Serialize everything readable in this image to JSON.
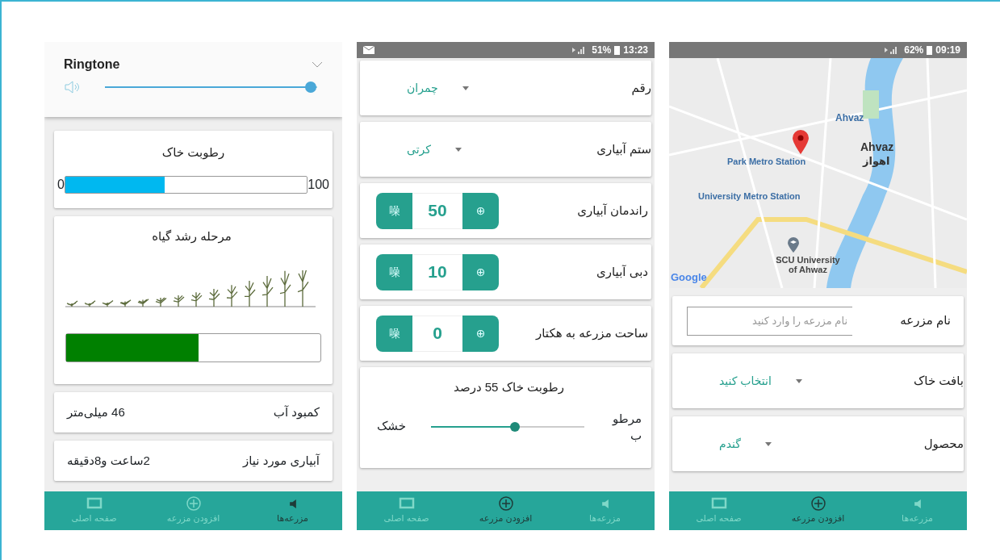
{
  "phones": [
    {
      "status_bar": {
        "mail_notification": false,
        "battery": "62%",
        "time": "09:19"
      },
      "map": {
        "labels": [
          {
            "kind": "metro",
            "text": "Ahvaz"
          },
          {
            "kind": "city",
            "text": "Ahvaz"
          },
          {
            "kind": "city_local",
            "text": "اهواز"
          },
          {
            "kind": "park_metro",
            "text": "Park Metro Station"
          },
          {
            "kind": "uni_metro",
            "text": "University Metro Station"
          },
          {
            "kind": "university",
            "text": "SCU University of Ahwaz"
          },
          {
            "kind": "google",
            "text": "Google"
          }
        ]
      },
      "rows": [
        {
          "kind": "input",
          "label": "نام مزرعه",
          "placeholder": "نام مزرعه را وارد کنید"
        },
        {
          "kind": "select",
          "label": "بافت خاک",
          "value": "انتخاب کنید"
        },
        {
          "kind": "select",
          "label": "محصول",
          "value": "گندم"
        }
      ],
      "nav": [
        {
          "label": "مزرعه‌ها",
          "selected": false
        },
        {
          "label": "افزودن مزرعه",
          "selected": true
        },
        {
          "label": "صفحه اصلی",
          "selected": false
        }
      ]
    },
    {
      "status_bar": {
        "mail_notification": true,
        "battery": "51%",
        "time": "13:23"
      },
      "rows": [
        {
          "kind": "select",
          "label": "رقم",
          "value": "چمران"
        },
        {
          "kind": "select",
          "label": "ستم آبیاری",
          "value": "کرتی"
        },
        {
          "kind": "stepper",
          "label": "راندمان آبیاری",
          "minus": "噪",
          "value": "50",
          "plus": "⊕"
        },
        {
          "kind": "stepper",
          "label": "دبی آبیاری",
          "minus": "噪",
          "value": "10",
          "plus": "⊕"
        },
        {
          "kind": "stepper",
          "label": "ساحت مزرعه به هکتار",
          "minus": "噪",
          "value": "0",
          "plus": "⊕"
        }
      ],
      "moisture_slider": {
        "title": "رطوبت خاک 55 درصد",
        "wet_label": "مرطوب",
        "dry_label": "خشک",
        "level": 0.55
      },
      "nav": [
        {
          "label": "مزرعه‌ها",
          "selected": false
        },
        {
          "label": "افزودن مزرعه",
          "selected": true
        },
        {
          "label": "صفحه اصلی",
          "selected": false
        }
      ]
    },
    {
      "volume_popup": {
        "title": "Ringtone",
        "level": 0.97
      },
      "soil_moisture": {
        "title": "رطوبت خاک",
        "min": "0",
        "max": "100",
        "level": 0.41
      },
      "growth_stage": {
        "title": "مرحله رشد گیاه",
        "level": 0.52
      },
      "info_rows": [
        {
          "label": "کمبود آب",
          "value": "46 میلی‌متر"
        },
        {
          "label": "آبیاری مورد نیاز",
          "value": "2ساعت و8دقیقه"
        }
      ],
      "nav": [
        {
          "label": "مزرعه‌ها",
          "selected": true
        },
        {
          "label": "افزودن مزرعه",
          "selected": false
        },
        {
          "label": "صفحه اصلی",
          "selected": false
        }
      ]
    }
  ]
}
